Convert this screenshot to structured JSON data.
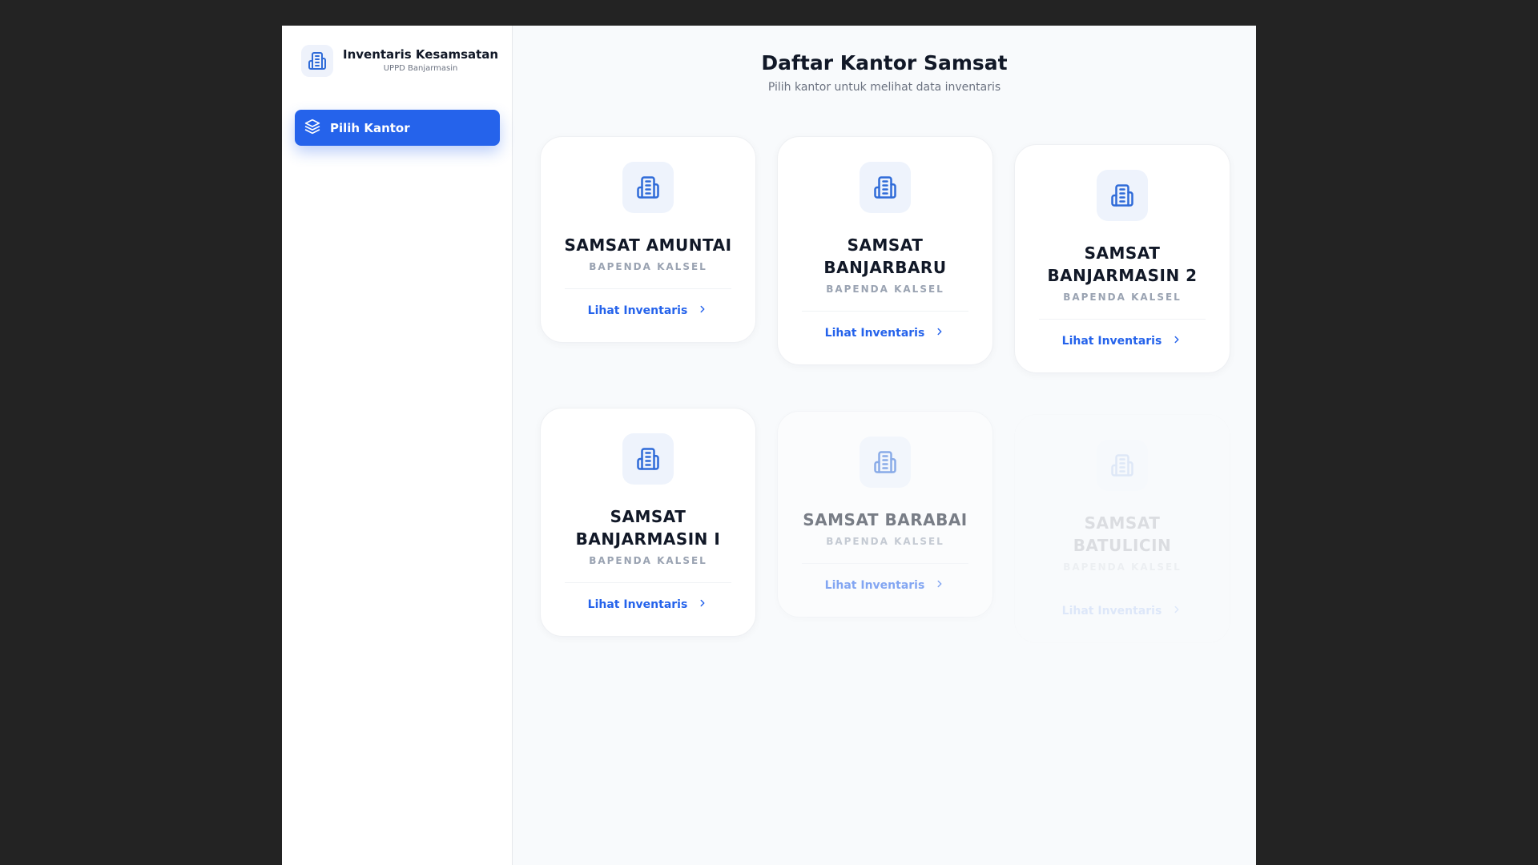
{
  "sidebar": {
    "brand_title": "Inventaris Kesamsatan",
    "brand_subtitle": "UPPD Banjarmasin",
    "brand_icon": "building-icon",
    "nav": [
      {
        "label": "Pilih Kantor",
        "icon": "layers-icon",
        "active": true
      }
    ]
  },
  "main": {
    "title": "Daftar Kantor Samsat",
    "subtitle": "Pilih kantor untuk melihat data inventaris"
  },
  "offices": [
    {
      "name": "SAMSAT AMUNTAI",
      "org": "BAPENDA KALSEL",
      "link": "Lihat Inventaris"
    },
    {
      "name": "SAMSAT BANJARBARU",
      "org": "BAPENDA KALSEL",
      "link": "Lihat Inventaris"
    },
    {
      "name": "SAMSAT BANJARMASIN 2",
      "org": "BAPENDA KALSEL",
      "link": "Lihat Inventaris"
    },
    {
      "name": "SAMSAT BANJARMASIN I",
      "org": "BAPENDA KALSEL",
      "link": "Lihat Inventaris"
    },
    {
      "name": "SAMSAT BARABAI",
      "org": "BAPENDA KALSEL",
      "link": "Lihat Inventaris"
    },
    {
      "name": "SAMSAT BATULICIN",
      "org": "BAPENDA KALSEL",
      "link": "Lihat Inventaris"
    }
  ],
  "colors": {
    "accent": "#2563eb",
    "background": "#f8fafc",
    "outer": "#232323"
  }
}
